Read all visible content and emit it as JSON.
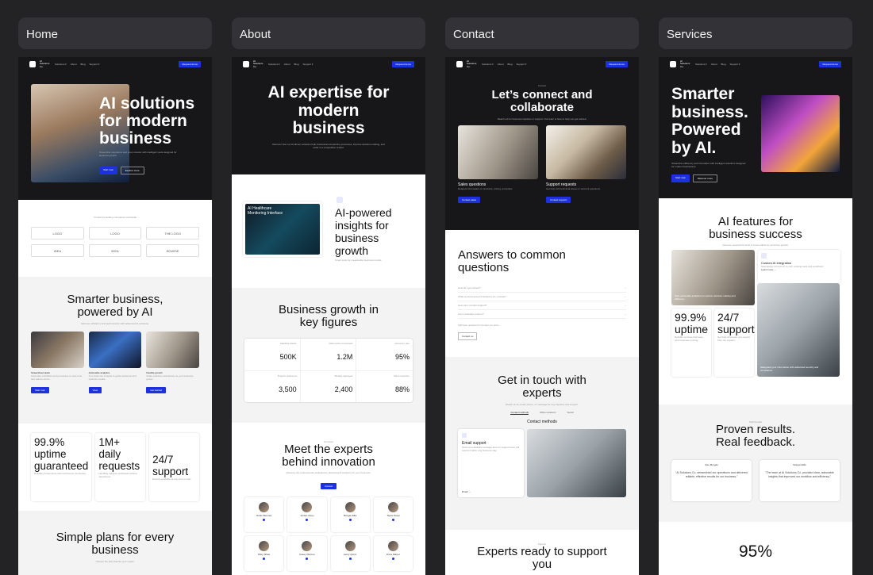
{
  "tabs": {
    "home": "Home",
    "about": "About",
    "contact": "Contact",
    "services": "Services"
  },
  "nav": {
    "brand": "AI Solutions Co.",
    "links": [
      "Solutions ▾",
      "About",
      "Blog",
      "Support ▾"
    ],
    "cta": "Request demo"
  },
  "home": {
    "hero_title": "AI solutions for modern business",
    "hero_sub": "Streamline operations and grow smarter with intelligent tools designed for business growth.",
    "btn_primary": "Start now",
    "btn_secondary": "Explore more",
    "trusted": "Trusted by leading companies worldwide",
    "logos": [
      "LOGO",
      "LOGO",
      "THE LOGO",
      "IDEA",
      "IDEA",
      "EDWISE"
    ],
    "section_title": "Smarter business, powered by AI",
    "section_sub": "Discover efficiency and performance with advanced AI solutions.",
    "features": [
      {
        "title": "Streamlined tasks",
        "desc": "Automate workflows and processes to save time and reduce errors.",
        "btn": "Start now"
      },
      {
        "title": "Actionable analytics",
        "desc": "Turn data into insights to guide decisions and optimize results.",
        "btn": "View"
      },
      {
        "title": "Flexible growth",
        "desc": "Scale solutions seamlessly as your business grows.",
        "btn": "Get started"
      }
    ],
    "stats": [
      {
        "value": "99.9% uptime guaranteed",
        "desc": "Reliable performance with continuous monitoring."
      },
      {
        "value": "1M+ daily requests",
        "desc": "Handling massive workloads without slowdowns."
      },
      {
        "value": "24/7 support",
        "desc": "Experts available at any time to help."
      }
    ],
    "plans_title": "Simple plans for every business",
    "plans_sub": "Choose the plan that fits your needs."
  },
  "about": {
    "hero_title": "AI expertise for modern business",
    "hero_sub": "Discover how our AI-driven solutions help businesses streamline processes, improve decision-making, and scale in a competitive market.",
    "dash_title": "AI Healthcare Monitoring Interface",
    "insights_title": "AI-powered insights for business growth",
    "insights_sub": "Smart tools for measurable business results.",
    "figures_title": "Business growth in key figures",
    "figures": [
      {
        "label": "Satisfied clients",
        "value": "500K"
      },
      {
        "label": "Data points processed",
        "value": "1.2M"
      },
      {
        "label": "Accuracy rate",
        "value": "95%"
      },
      {
        "label": "Projects delivered",
        "value": "3,500"
      },
      {
        "label": "Models deployed",
        "value": "2,400"
      },
      {
        "label": "Client retention",
        "value": "88%"
      }
    ],
    "team_tag": "Our team",
    "team_title": "Meet the experts behind innovation",
    "team_sub": "Discover the professionals dedicated to delivering AI solutions for your business.",
    "team_btn": "Contact",
    "members": [
      "Nolan Bennett",
      "Jordan Avery",
      "Morgan Ellis",
      "Taylor Reed",
      "Riley Shaw",
      "Casey Monroe",
      "Avery Quinn",
      "Drew Harper"
    ]
  },
  "contact": {
    "tag": "Contact",
    "hero_title": "Let’s connect and collaborate",
    "hero_sub": "Reach out for business inquiries or support. Our team is here to help you get started.",
    "cards": [
      {
        "title": "Sales questions",
        "desc": "Request information on products, pricing, and plans.",
        "btn": "Contact sales"
      },
      {
        "title": "Support requests",
        "desc": "Get help with technical issues or account questions.",
        "btn": "Contact support"
      }
    ],
    "faq_title": "Answers to common questions",
    "faq": [
      "How do I get started?",
      "What services does AI Solutions Co. provide?",
      "How can I contact support?",
      "Can I schedule a demo?"
    ],
    "faq_more": "Still have questions? Contact our team.",
    "faq_btn": "Contact us",
    "touch_title": "Get in touch with experts",
    "touch_sub": "Reach us by email, phone, or message for any inquiries and support.",
    "tabs": [
      "Contact methods",
      "Office locations",
      "Social"
    ],
    "methods_label": "Contact methods",
    "email_title": "Email support",
    "email_desc": "Send us a detailed message and our support team will respond within one business day.",
    "email_link": "Email →",
    "experts_tag": "Support",
    "experts_title": "Experts ready to support you"
  },
  "services": {
    "hero_title": "Smarter business. Powered by AI.",
    "hero_sub": "Streamline efficiency and innovation with intelligent solutions designed for modern businesses.",
    "btn_primary": "Start now",
    "btn_secondary": "Discover more",
    "features_title": "AI features for business success",
    "features_sub": "Discover powerful AI tools to boost efficiency and drive growth.",
    "integration_title": "Custom AI integration",
    "integration_desc": "Seamlessly connect AI to your existing tools and workflows.",
    "learn_more": "Learn more →",
    "analytics_caption": "Gain actionable analytics to improve decision-making and efficiency.",
    "stat_uptime": "99.9% uptime",
    "stat_uptime_desc": "Reliable services that keep your business running.",
    "stat_support": "24/7 support",
    "stat_support_desc": "Get help whenever you need it from our experts.",
    "protect_caption": "Safeguard your information with advanced security and compliance.",
    "results_tag": "Testimonials",
    "results_title": "Proven results. Real feedback.",
    "testimonials": [
      {
        "name": "Alex Morgan",
        "quote": "“AI Solutions Co. streamlined our operations and delivered reliable, effective results for our business.”"
      },
      {
        "name": "Morgan Ellis",
        "quote": "“The team at AI Solutions Co. provided clear, actionable insights that improved our workflow and efficiency.”"
      }
    ],
    "big_stat": "95%"
  }
}
